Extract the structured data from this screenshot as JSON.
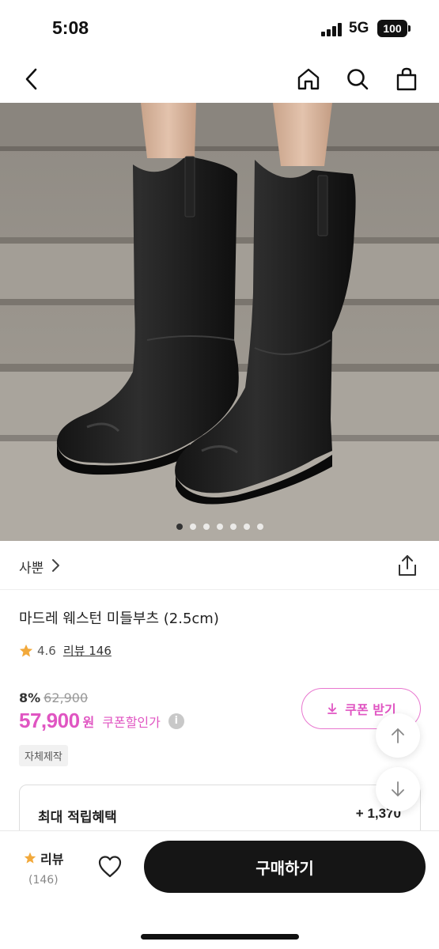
{
  "status_bar": {
    "time": "5:08",
    "network": "5G",
    "battery": "100"
  },
  "product": {
    "brand": "사뿐",
    "title": "마드레 웨스턴 미들부츠 (2.5cm)",
    "rating": "4.6",
    "review_label": "리뷰 146",
    "discount_rate": "8%",
    "original_price": "62,900",
    "price": "57,900",
    "currency": "원",
    "coupon_price_label": "쿠폰할인가",
    "info_icon": "i",
    "tag": "자체제작",
    "image_count": 7,
    "active_image_index": 1
  },
  "coupon_button": {
    "label": "쿠폰 받기"
  },
  "benefit": {
    "label": "최대 적립혜택",
    "value": "+ 1,370"
  },
  "bottom_bar": {
    "review_label": "리뷰",
    "review_count": "(146)",
    "buy_label": "구매하기"
  },
  "icons": {
    "back": "chevron-left-icon",
    "home": "home-icon",
    "search": "search-icon",
    "cart": "shopping-bag-icon",
    "share": "share-icon",
    "star": "star-icon",
    "heart": "heart-icon"
  },
  "colors": {
    "accent": "#e055c2",
    "star": "#f2a93b",
    "buy_button": "#151515"
  }
}
